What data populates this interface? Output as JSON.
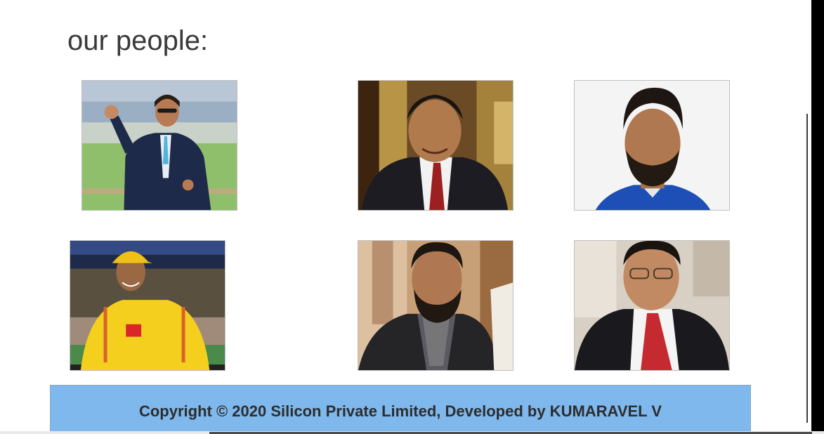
{
  "heading": "our people:",
  "people": [
    {
      "photo": "person-photo-1",
      "description": "man in navy suit waving on cricket ground"
    },
    {
      "photo": "person-photo-2",
      "description": "man in dark suit with red tie"
    },
    {
      "photo": "person-photo-3",
      "description": "bearded man in blue jersey"
    },
    {
      "photo": "person-photo-4",
      "description": "man in yellow cricket jersey and cap"
    },
    {
      "photo": "person-photo-5",
      "description": "bearded man in dark blazer"
    },
    {
      "photo": "person-photo-6",
      "description": "man with glasses in suit and red tie"
    }
  ],
  "footer": {
    "text": "Copyright © 2020 Silicon Private Limited, Developed by KUMARAVEL V",
    "background": "#7fb8ec"
  }
}
